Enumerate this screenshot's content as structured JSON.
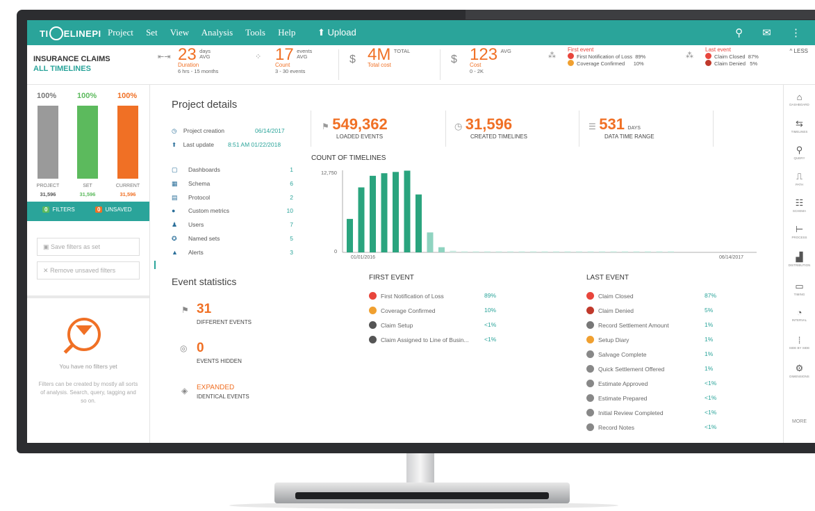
{
  "topbar": {
    "logo": "TI",
    "logo_rest": "ELINEPI",
    "menu": [
      "Project",
      "Set",
      "View",
      "Analysis",
      "Tools",
      "Help"
    ],
    "upload": "Upload"
  },
  "summary": {
    "title": "INSURANCE CLAIMS",
    "subtitle": "ALL TIMELINES",
    "duration": {
      "value": "23",
      "unit1": "days",
      "unit2": "AVG",
      "label": "Duration",
      "sub": "6 hrs - 15 months"
    },
    "count": {
      "value": "17",
      "unit1": "events",
      "unit2": "AVG",
      "label": "Count",
      "sub": "3 - 30 events"
    },
    "total": {
      "value": "4M",
      "unit1": "TOTAL",
      "label": "Total cost"
    },
    "cost": {
      "value": "123",
      "unit1": "AVG",
      "label": "Cost",
      "sub": "0 - 2K"
    },
    "first_event": {
      "title": "First event",
      "rows": [
        {
          "name": "First Notification of Loss",
          "pct": "89%"
        },
        {
          "name": "Coverage Confirmed",
          "pct": "10%"
        }
      ]
    },
    "last_event": {
      "title": "Last event",
      "rows": [
        {
          "name": "Claim Closed",
          "pct": "87%"
        },
        {
          "name": "Claim Denied",
          "pct": "5%"
        }
      ]
    },
    "less": "LESS"
  },
  "left": {
    "bars": [
      {
        "pct": "100%",
        "label": "PROJECT",
        "value": "31,596",
        "color": "#9a9a9a"
      },
      {
        "pct": "100%",
        "label": "SET",
        "value": "31,596",
        "color": "#5cba5d"
      },
      {
        "pct": "100%",
        "label": "CURRENT",
        "value": "31,596",
        "color": "#f07025"
      }
    ],
    "filters_count": "0",
    "filters_label": "FILTERS",
    "unsaved_count": "0",
    "unsaved_label": "UNSAVED",
    "save_filters": "Save filters as set",
    "remove_filters": "Remove unsaved filters",
    "no_filters": "You have no filters yet",
    "no_filters_desc": "Filters can be created by mostly all sorts of analysis. Search, query, tagging and so on."
  },
  "project": {
    "title": "Project details",
    "creation_label": "Project creation",
    "creation_value": "06/14/2017",
    "update_label": "Last update",
    "update_value": "8:51 AM 01/22/2018",
    "items": [
      {
        "label": "Dashboards",
        "value": "1"
      },
      {
        "label": "Schema",
        "value": "6"
      },
      {
        "label": "Protocol",
        "value": "2"
      },
      {
        "label": "Custom metrics",
        "value": "10"
      },
      {
        "label": "Users",
        "value": "7"
      },
      {
        "label": "Named sets",
        "value": "5"
      },
      {
        "label": "Alerts",
        "value": "3"
      }
    ],
    "loaded": {
      "value": "549,362",
      "label": "LOADED EVENTS"
    },
    "created": {
      "value": "31,596",
      "label": "CREATED TIMELINES"
    },
    "range": {
      "value": "531",
      "unit": "DAYS",
      "label": "DATA TIME RANGE"
    }
  },
  "chart_data": {
    "type": "bar",
    "title": "COUNT OF TIMELINES",
    "ylim": [
      0,
      12750
    ],
    "y_ticks": [
      "12,750",
      "0"
    ],
    "x_start": "01/01/2016",
    "x_end": "06/14/2017",
    "values": [
      5200,
      10100,
      11900,
      12300,
      12500,
      12700,
      9000,
      3100,
      800,
      250,
      150,
      100,
      80,
      70,
      60,
      60,
      55,
      50,
      50,
      45,
      45,
      40,
      40,
      40,
      35,
      35,
      35,
      30,
      30
    ]
  },
  "events": {
    "title": "Event statistics",
    "different": {
      "value": "31",
      "label": "DIFFERENT EVENTS"
    },
    "hidden": {
      "value": "0",
      "label": "EVENTS HIDDEN"
    },
    "expanded": {
      "value": "EXPANDED",
      "label": "IDENTICAL EVENTS"
    }
  },
  "first_event": {
    "title": "FIRST EVENT",
    "rows": [
      {
        "name": "First Notification of Loss",
        "pct": "89%",
        "color": "#e8453c"
      },
      {
        "name": "Coverage Confirmed",
        "pct": "10%",
        "color": "#f0a030"
      },
      {
        "name": "Claim Setup",
        "pct": "<1%",
        "color": "#555555"
      },
      {
        "name": "Claim Assigned to Line of Busin...",
        "pct": "<1%",
        "color": "#555555"
      }
    ]
  },
  "last_event": {
    "title": "LAST EVENT",
    "rows": [
      {
        "name": "Claim Closed",
        "pct": "87%",
        "color": "#e8453c"
      },
      {
        "name": "Claim Denied",
        "pct": "5%",
        "color": "#c0392b"
      },
      {
        "name": "Record Settlement Amount",
        "pct": "1%",
        "color": "#777777"
      },
      {
        "name": "Setup Diary",
        "pct": "1%",
        "color": "#f0a030"
      },
      {
        "name": "Salvage Complete",
        "pct": "1%",
        "color": "#888888"
      },
      {
        "name": "Quick Settlement Offered",
        "pct": "1%",
        "color": "#888888"
      },
      {
        "name": "Estimate Approved",
        "pct": "<1%",
        "color": "#888888"
      },
      {
        "name": "Estimate Prepared",
        "pct": "<1%",
        "color": "#888888"
      },
      {
        "name": "Initial Review Completed",
        "pct": "<1%",
        "color": "#888888"
      },
      {
        "name": "Record Notes",
        "pct": "<1%",
        "color": "#888888"
      }
    ]
  },
  "rightbar": [
    {
      "glyph": "⌂",
      "label": "DASHBOARD"
    },
    {
      "glyph": "⇆",
      "label": "TIMELINES"
    },
    {
      "glyph": "⚲",
      "label": "QUERY"
    },
    {
      "glyph": "⎍",
      "label": "PATH"
    },
    {
      "glyph": "☷",
      "label": "SCHEMA"
    },
    {
      "glyph": "⊢",
      "label": "PROCESS"
    },
    {
      "glyph": "▟",
      "label": "DISTRIBUTION"
    },
    {
      "glyph": "▭",
      "label": "TIMING"
    },
    {
      "glyph": "◔",
      "label": "INTERVAL"
    },
    {
      "glyph": "⁞",
      "label": "SIDE BY SIDE"
    },
    {
      "glyph": "⚙",
      "label": "DIMENSIONS"
    },
    {
      "glyph": "",
      "label": "MORE"
    }
  ]
}
